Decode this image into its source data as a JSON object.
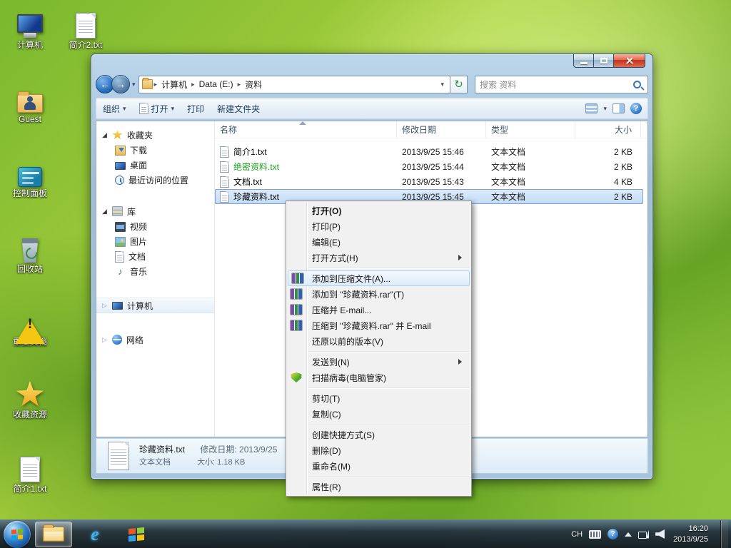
{
  "desktop": {
    "icons": [
      {
        "label": "计算机"
      },
      {
        "label": "简介2.txt"
      },
      {
        "label": "Guest"
      },
      {
        "label": "控制面板"
      },
      {
        "label": "回收站"
      },
      {
        "label": "重要文档"
      },
      {
        "label": "收藏资源"
      },
      {
        "label": "简介1.txt"
      }
    ]
  },
  "explorer": {
    "breadcrumbs": [
      "计算机",
      "Data (E:)",
      "资料"
    ],
    "search_placeholder": "搜索 资料",
    "toolbar": {
      "organize": "组织",
      "open": "打开",
      "print": "打印",
      "new_folder": "新建文件夹"
    },
    "sidebar": {
      "favorites_label": "收藏夹",
      "favorites": [
        "下载",
        "桌面",
        "最近访问的位置"
      ],
      "libraries_label": "库",
      "libraries": [
        "视频",
        "图片",
        "文档",
        "音乐"
      ],
      "computer_label": "计算机",
      "network_label": "网络"
    },
    "columns": {
      "name": "名称",
      "date": "修改日期",
      "type": "类型",
      "size": "大小"
    },
    "files": [
      {
        "name": "简介1.txt",
        "date": "2013/9/25 15:46",
        "type": "文本文档",
        "size": "2 KB"
      },
      {
        "name": "绝密资料.txt",
        "date": "2013/9/25 15:44",
        "type": "文本文档",
        "size": "2 KB"
      },
      {
        "name": "文档.txt",
        "date": "2013/9/25 15:43",
        "type": "文本文档",
        "size": "4 KB"
      },
      {
        "name": "珍藏资料.txt",
        "date": "2013/9/25 15:45",
        "type": "文本文档",
        "size": "2 KB"
      }
    ],
    "details_pane": {
      "filename": "珍藏资料.txt",
      "modified": "修改日期: 2013/9/25",
      "type": "文本文档",
      "size": "大小: 1.18 KB"
    }
  },
  "context_menu": {
    "items": [
      {
        "label": "打开(O)"
      },
      {
        "label": "打印(P)"
      },
      {
        "label": "编辑(E)"
      },
      {
        "label": "打开方式(H)"
      },
      {
        "label": "添加到压缩文件(A)..."
      },
      {
        "label": "添加到 \"珍藏资料.rar\"(T)"
      },
      {
        "label": "压缩并 E-mail..."
      },
      {
        "label": "压缩到 \"珍藏资料.rar\" 并 E-mail"
      },
      {
        "label": "还原以前的版本(V)"
      },
      {
        "label": "发送到(N)"
      },
      {
        "label": "扫描病毒(电脑管家)"
      },
      {
        "label": "剪切(T)"
      },
      {
        "label": "复制(C)"
      },
      {
        "label": "创建快捷方式(S)"
      },
      {
        "label": "删除(D)"
      },
      {
        "label": "重命名(M)"
      },
      {
        "label": "属性(R)"
      }
    ]
  },
  "taskbar": {
    "tray": {
      "input": "CH",
      "time": "16:20",
      "date": "2013/9/25"
    }
  },
  "colors": {
    "encrypted_filename": "#16a11b",
    "selection_fill": "#c2dcf6",
    "selection_border": "#7da2ce",
    "menu_highlight_border": "#aed0f0",
    "close_button": "#c3321c",
    "wallpaper_green": "#7ab82e"
  }
}
